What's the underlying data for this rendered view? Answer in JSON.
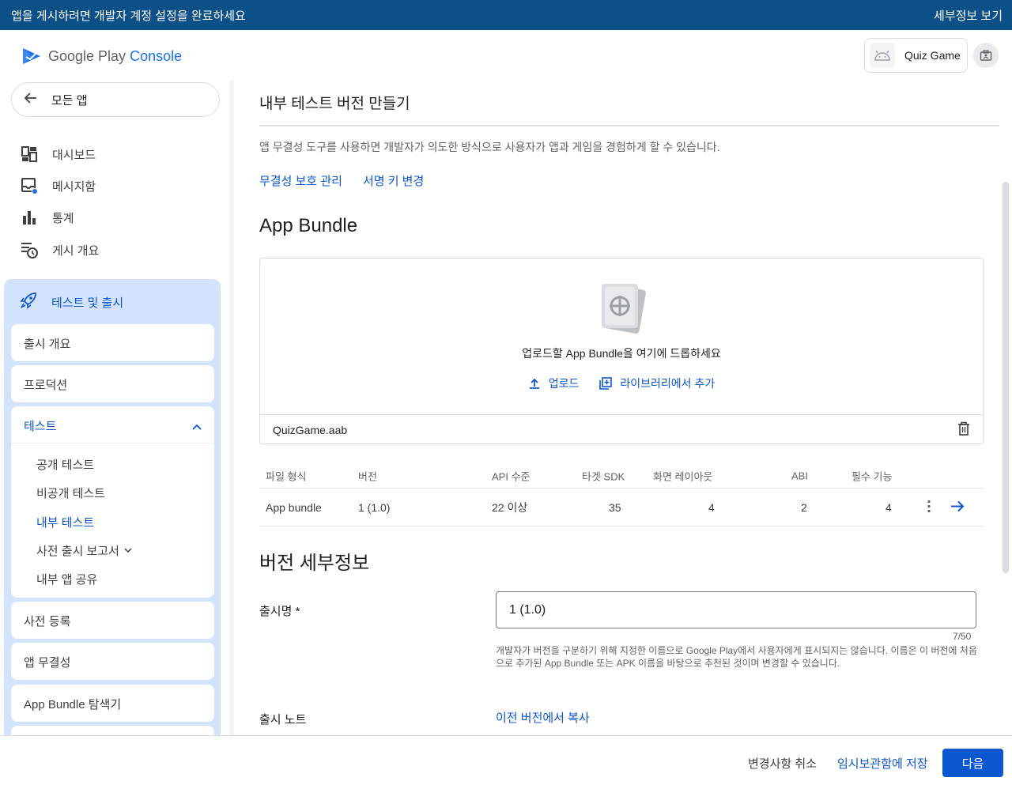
{
  "banner": {
    "message": "앱을 게시하려면 개발자 계정 설정을 완료하세요",
    "details_link": "세부정보 보기"
  },
  "header": {
    "logo_brand": "Google Play",
    "logo_product": "Console",
    "app_name": "Quiz Game"
  },
  "sidebar": {
    "back_label": "모든 앱",
    "items": [
      {
        "label": "대시보드",
        "icon": "dashboard-icon"
      },
      {
        "label": "메시지함",
        "icon": "inbox-icon"
      },
      {
        "label": "통계",
        "icon": "bar-chart-icon"
      },
      {
        "label": "게시 개요",
        "icon": "publishing-overview-icon"
      }
    ],
    "group_label": "테스트 및 출시",
    "cards": {
      "release_overview": "출시 개요",
      "production": "프로덕션",
      "testing": "테스트",
      "pre_registration": "사전 등록",
      "app_integrity": "앱 무결성",
      "bundle_explorer": "App Bundle 탐색기"
    },
    "testing_sub": [
      "공개 테스트",
      "비공개 테스트",
      "내부 테스트",
      "사전 출시 보고서",
      "내부 앱 공유"
    ]
  },
  "main": {
    "title": "내부 테스트 버전 만들기",
    "description": "앱 무결성 도구를 사용하면 개발자가 의도한 방식으로 사용자가 앱과 게임을 경험하게 할 수 있습니다.",
    "links": {
      "integrity": "무결성 보호 관리",
      "signing_key": "서명 키 변경"
    },
    "bundle_heading": "App Bundle",
    "drop_hint": "업로드할 App Bundle을 여기에 드롭하세요",
    "upload_label": "업로드",
    "library_label": "라이브러리에서 추가",
    "file_name": "QuizGame.aab",
    "table": {
      "headers": [
        "파일 형식",
        "버전",
        "API 수준",
        "타겟 SDK",
        "화면 레이아웃",
        "ABI",
        "필수 기능"
      ],
      "row": [
        "App bundle",
        "1 (1.0)",
        "22 이상",
        "35",
        "4",
        "2",
        "4"
      ]
    },
    "version_heading": "버전 세부정보",
    "release_name_label": "출시명 *",
    "release_name_value": "1 (1.0)",
    "release_name_counter": "7/50",
    "release_name_helper": "개발자가 버전을 구분하기 위해 지정한 이름으로 Google Play에서 사용자에게 표시되지는 않습니다. 이름은 이 버전에 처음으로 추가된 App Bundle 또는 APK 이름을 바탕으로 추천된 것이며 변경할 수 있습니다.",
    "release_notes_label": "출시 노트",
    "copy_prev_label": "이전 버전에서 복사"
  },
  "footer": {
    "discard": "변경사항 취소",
    "save_draft": "임시보관함에 저장",
    "next": "다음"
  },
  "colors": {
    "accent": "#0b57d0",
    "banner": "#0d5087",
    "group_bg": "#d3e3fd"
  }
}
